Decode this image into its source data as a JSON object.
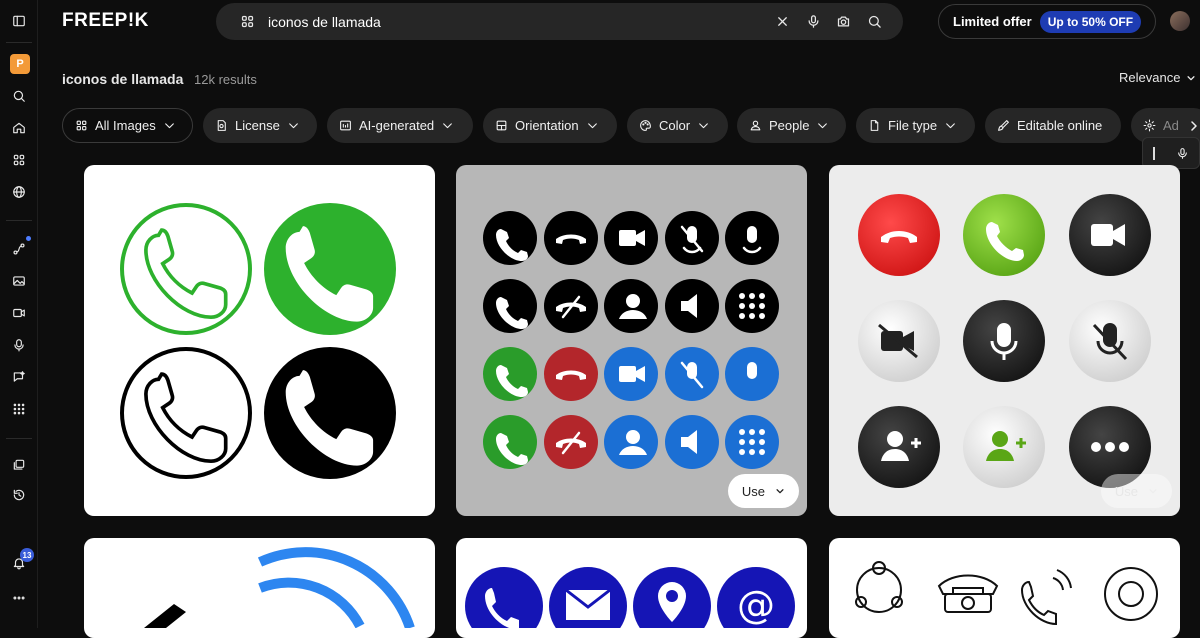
{
  "header": {
    "logo_text": "FREEP!K",
    "search": {
      "value": "iconos de llamada",
      "placeholder": ""
    },
    "offer": {
      "label": "Limited offer",
      "pill": "Up to 50% OFF"
    }
  },
  "sidebar": {
    "workspace_badge": "P",
    "notifications_count": "13"
  },
  "results": {
    "query": "iconos de llamada",
    "count": "12k results",
    "sort": "Relevance"
  },
  "filters": [
    {
      "label": "All Images",
      "icon": "grid-icon"
    },
    {
      "label": "License",
      "icon": "license-icon"
    },
    {
      "label": "AI-generated",
      "icon": "ai-icon"
    },
    {
      "label": "Orientation",
      "icon": "orientation-icon"
    },
    {
      "label": "Color",
      "icon": "palette-icon"
    },
    {
      "label": "People",
      "icon": "people-icon"
    },
    {
      "label": "File type",
      "icon": "file-icon"
    },
    {
      "label": "Editable online",
      "icon": "brush-icon"
    },
    {
      "label": "Ad",
      "icon": "gear-icon"
    }
  ],
  "cards": {
    "use_label": "Use"
  },
  "colors": {
    "accent_blue": "#1e3cb3",
    "call_green": "#2db12d",
    "call_red": "#e8242e",
    "badge_orange": "#f39a38"
  }
}
